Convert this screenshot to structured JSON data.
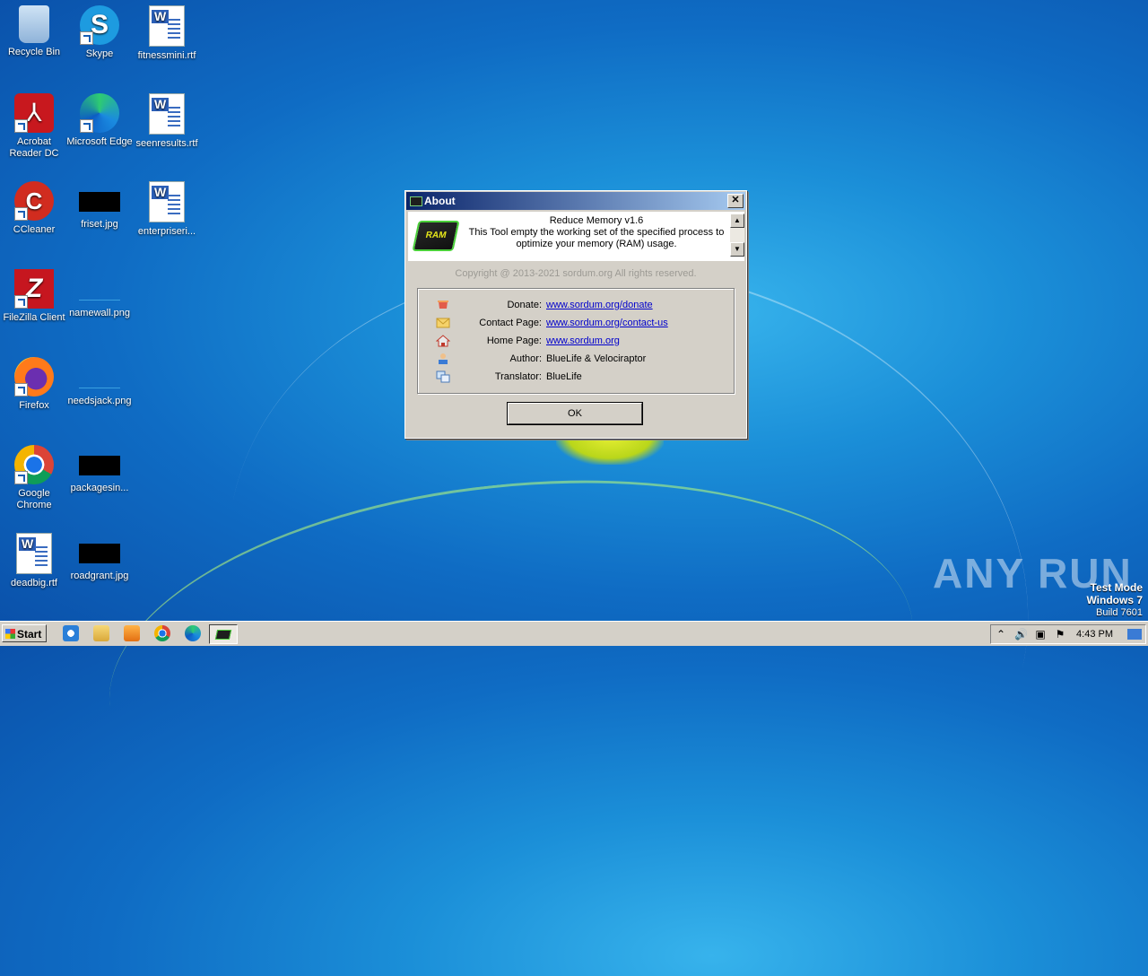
{
  "desktop": {
    "icons": [
      {
        "label": "Recycle Bin"
      },
      {
        "label": "Skype"
      },
      {
        "label": "fitnessmini.rtf"
      },
      {
        "label": "Acrobat Reader DC"
      },
      {
        "label": "Microsoft Edge"
      },
      {
        "label": "seenresults.rtf"
      },
      {
        "label": "CCleaner"
      },
      {
        "label": "friset.jpg"
      },
      {
        "label": "enterpriseri..."
      },
      {
        "label": "FileZilla Client"
      },
      {
        "label": "namewall.png"
      },
      {
        "label": "Firefox"
      },
      {
        "label": "needsjack.png"
      },
      {
        "label": "Google Chrome"
      },
      {
        "label": "packagesin..."
      },
      {
        "label": "deadbig.rtf"
      },
      {
        "label": "roadgrant.jpg"
      }
    ]
  },
  "dialog": {
    "title": "About",
    "close_label": "✕",
    "app_name": "Reduce Memory v1.6",
    "description_line1": "This Tool empty the working set of the specified process to",
    "description_line2": "optimize your memory (RAM) usage.",
    "ram_badge": "RAM",
    "copyright": "Copyright @ 2013-2021 sordum.org All rights reserved.",
    "rows": [
      {
        "label": "Donate:",
        "value": "www.sordum.org/donate",
        "icon": "donate-icon"
      },
      {
        "label": "Contact Page:",
        "value": "www.sordum.org/contact-us",
        "icon": "mail-icon"
      },
      {
        "label": "Home Page:",
        "value": "www.sordum.org",
        "icon": "home-icon"
      },
      {
        "label": "Author:",
        "value": "BlueLife & Velociraptor",
        "icon": "author-icon"
      },
      {
        "label": "Translator:",
        "value": "BlueLife",
        "icon": "translator-icon"
      }
    ],
    "ok_label": "OK"
  },
  "watermark": "ANY RUN",
  "test_mode": {
    "line1": "Test Mode",
    "line2": "Windows 7",
    "line3": "Build 7601"
  },
  "taskbar": {
    "start_label": "Start",
    "clock": "4:43 PM",
    "pinned": [
      "ie-icon",
      "explorer-icon",
      "media-player-icon",
      "chrome-icon",
      "edge-icon",
      "reduce-memory-icon"
    ]
  }
}
